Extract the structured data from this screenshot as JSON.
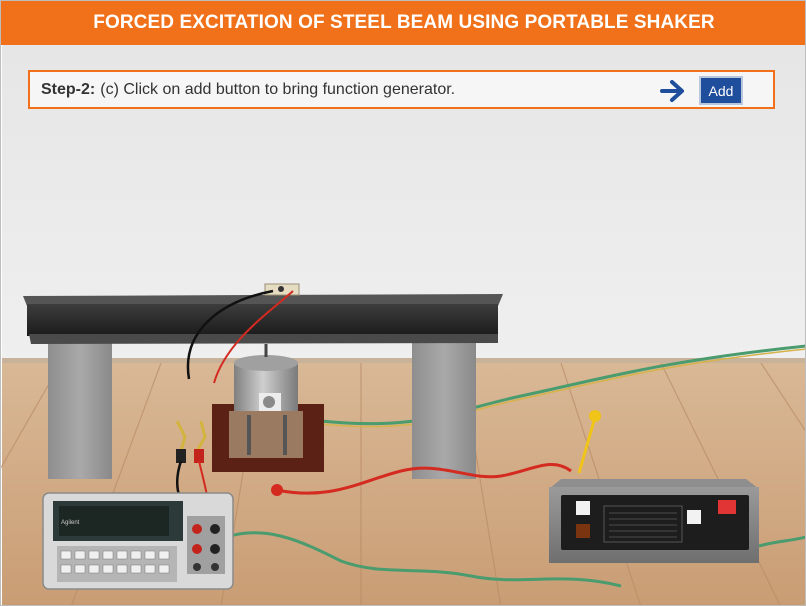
{
  "header": {
    "title": "FORCED EXCITATION OF STEEL BEAM USING PORTABLE SHAKER"
  },
  "instruction": {
    "step_label": "Step-2:",
    "text": "(c) Click on add button to bring function generator.",
    "add_button": "Add",
    "arrow_icon": "right-arrow-icon"
  },
  "colors": {
    "accent": "#f07119",
    "button": "#1f4e9c",
    "wire_red": "#d42a20",
    "wire_green": "#4a9b6e"
  },
  "equipment": {
    "multimeter_brand": "Agilent"
  }
}
